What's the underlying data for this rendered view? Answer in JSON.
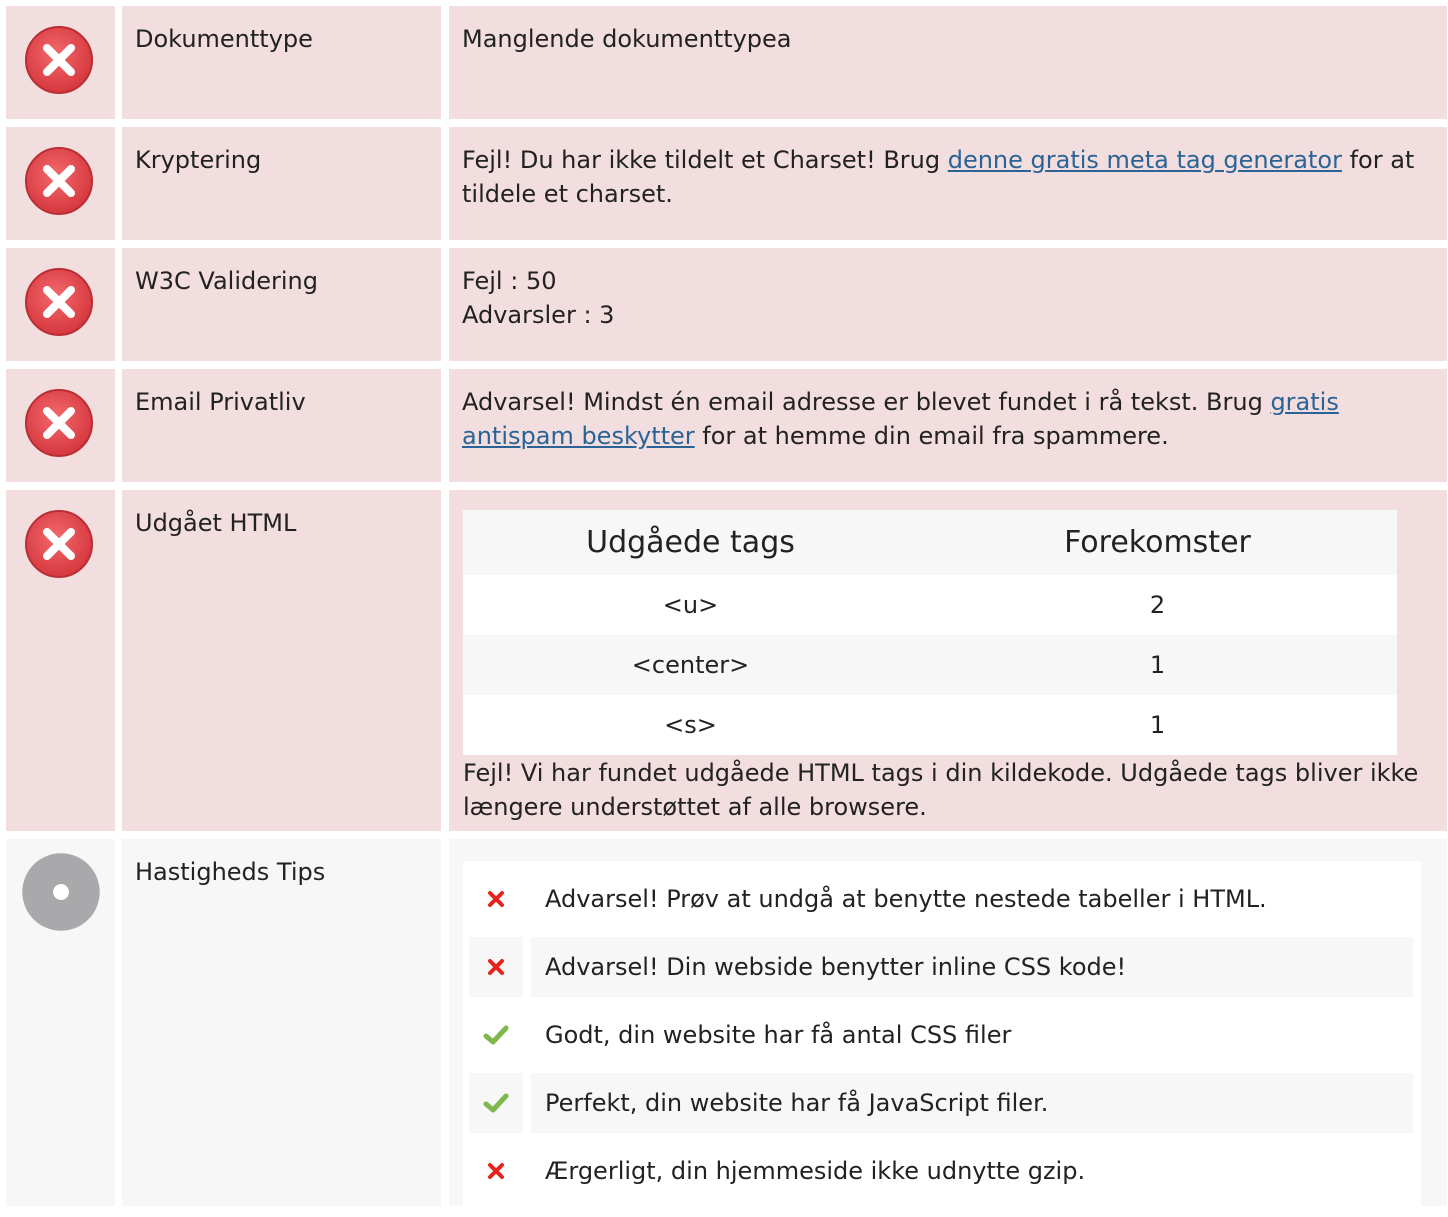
{
  "rows": [
    {
      "status": "error",
      "label": "Dokumenttype",
      "text": "Manglende dokumenttypea"
    },
    {
      "status": "error",
      "label": "Kryptering",
      "text_before": "Fejl! Du har ikke tildelt et Charset! Brug ",
      "link": "denne gratis meta tag generator",
      "text_after": " for at tildele et charset."
    },
    {
      "status": "error",
      "label": "W3C Validering",
      "line1": "Fejl : 50",
      "line2": "Advarsler : 3"
    },
    {
      "status": "error",
      "label": "Email Privatliv",
      "text_before": "Advarsel! Mindst én email adresse er blevet fundet i rå tekst. Brug ",
      "link": "gratis antispam beskytter",
      "text_after": " for at hemme din email fra spammere."
    },
    {
      "status": "error",
      "label": "Udgået HTML",
      "table": {
        "headers": [
          "Udgåede tags",
          "Forekomster"
        ],
        "rows": [
          {
            "tag": "<u>",
            "count": "2"
          },
          {
            "tag": "<center>",
            "count": "1"
          },
          {
            "tag": "<s>",
            "count": "1"
          }
        ]
      },
      "note": "Fejl! Vi har fundet udgåede HTML tags i din kildekode. Udgåede tags bliver ikke længere understøttet af alle browsere."
    },
    {
      "status": "neutral",
      "label": "Hastigheds Tips",
      "tips": [
        {
          "icon": "cross-icon",
          "text": "Advarsel! Prøv at undgå at benytte nestede tabeller i HTML."
        },
        {
          "icon": "cross-icon",
          "text": "Advarsel! Din webside benytter inline CSS kode!"
        },
        {
          "icon": "check-icon",
          "text": "Godt, din website har få antal CSS filer"
        },
        {
          "icon": "check-icon",
          "text": "Perfekt, din website har få JavaScript filer."
        },
        {
          "icon": "cross-icon",
          "text": "Ærgerligt, din hjemmeside ikke udnytte gzip."
        }
      ]
    }
  ],
  "colors": {
    "error_bg": "#f2dede",
    "neutral_bg": "#f7f7f7",
    "error_icon": "#e0464b",
    "neutral_icon": "#a9a9ab",
    "link": "#2a6496",
    "cross": "#e8221c",
    "check": "#7cb84a"
  }
}
